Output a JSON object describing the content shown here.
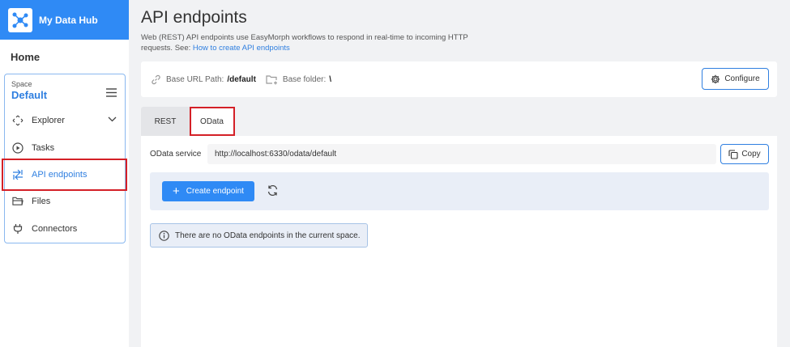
{
  "brand": {
    "name": "My Data Hub",
    "logo_icon": "network-logo-icon",
    "color": "#2f8af5"
  },
  "sidebar": {
    "home_label": "Home",
    "space": {
      "label": "Space",
      "value": "Default"
    },
    "items": [
      {
        "label": "Explorer",
        "icon": "explorer-icon",
        "has_chevron": true
      },
      {
        "label": "Tasks",
        "icon": "play-circle-icon"
      },
      {
        "label": "API endpoints",
        "icon": "api-arrows-icon",
        "active": true
      },
      {
        "label": "Files",
        "icon": "folder-icon"
      },
      {
        "label": "Connectors",
        "icon": "plug-icon"
      }
    ]
  },
  "page": {
    "title": "API endpoints",
    "description": "Web (REST) API endpoints use EasyMorph workflows to respond in real-time to incoming HTTP requests. See:",
    "description_link": "How to create API endpoints"
  },
  "base": {
    "url_path_label": "Base URL Path:",
    "url_path_value": "/default",
    "folder_label": "Base folder:",
    "folder_value": "\\",
    "configure_label": "Configure"
  },
  "tabs": [
    {
      "label": "REST",
      "active": false
    },
    {
      "label": "OData",
      "active": true
    }
  ],
  "odata": {
    "service_label": "OData service",
    "service_url": "http://localhost:6330/odata/default",
    "copy_label": "Copy",
    "create_label": "Create endpoint",
    "info_text": "There are no OData endpoints in the current space."
  },
  "colors": {
    "accent": "#2f7fe0",
    "highlight": "#d42027"
  }
}
